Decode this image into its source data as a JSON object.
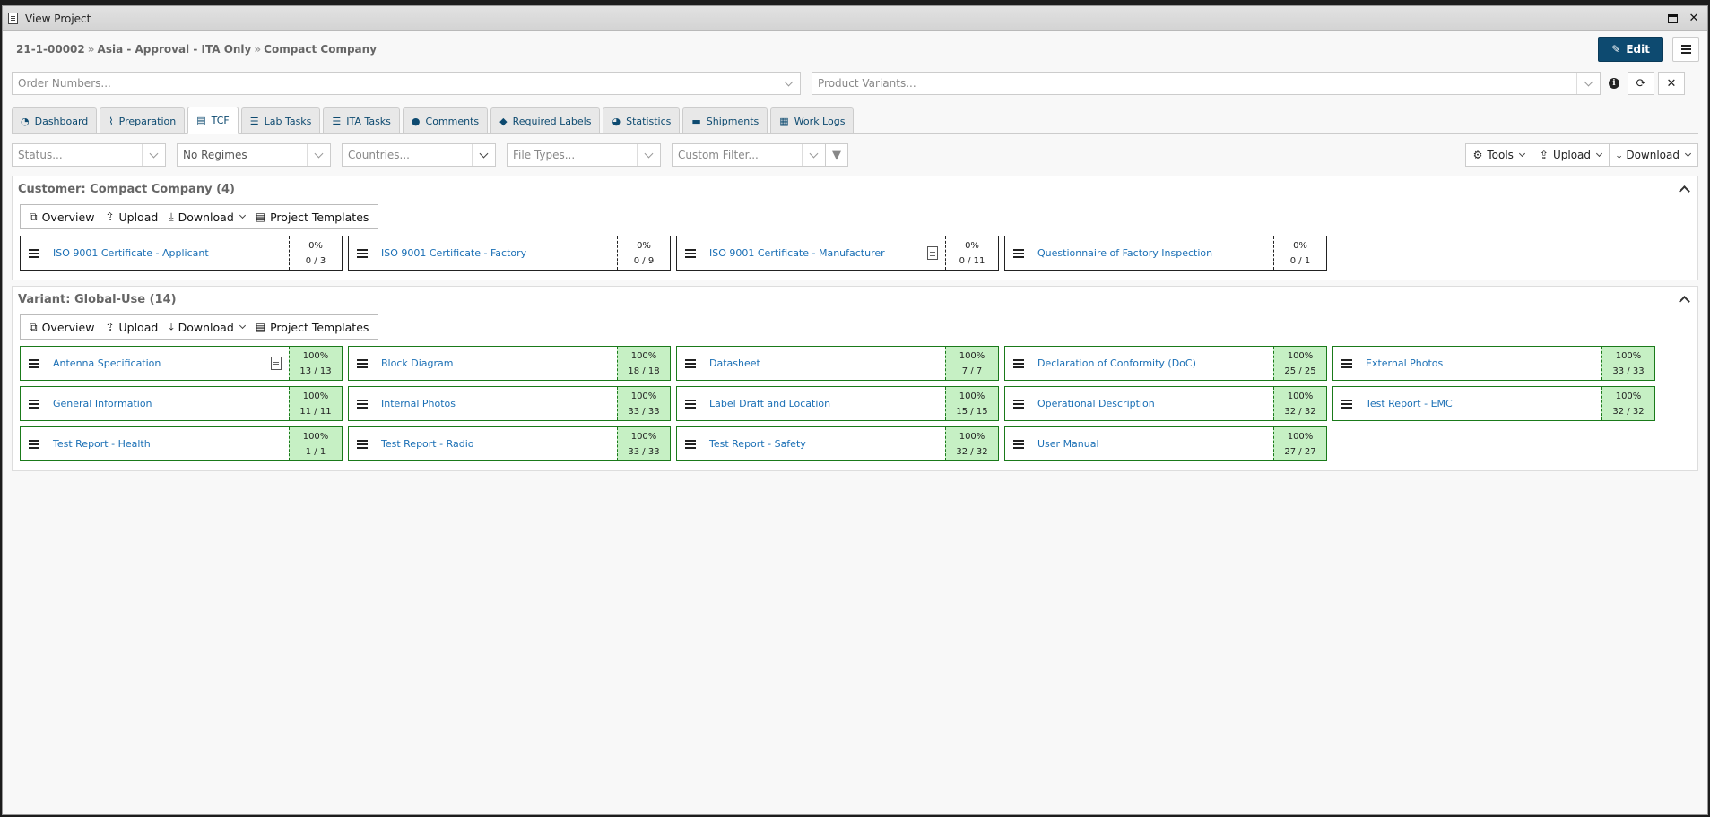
{
  "window": {
    "title": "View Project"
  },
  "breadcrumb": {
    "project_id": "21-1-00002",
    "approval": "Asia - Approval - ITA Only",
    "company": "Compact Company"
  },
  "header": {
    "edit_label": "Edit"
  },
  "selects": {
    "order_numbers": "Order Numbers...",
    "product_variants": "Product Variants..."
  },
  "tabs": [
    {
      "label": "Dashboard",
      "icon": "dashboard-icon"
    },
    {
      "label": "Preparation",
      "icon": "paperclip-icon"
    },
    {
      "label": "TCF",
      "icon": "file-icon",
      "active": true
    },
    {
      "label": "Lab Tasks",
      "icon": "server-icon"
    },
    {
      "label": "ITA Tasks",
      "icon": "server-icon"
    },
    {
      "label": "Comments",
      "icon": "comment-icon"
    },
    {
      "label": "Required Labels",
      "icon": "tags-icon"
    },
    {
      "label": "Statistics",
      "icon": "pie-chart-icon"
    },
    {
      "label": "Shipments",
      "icon": "truck-icon"
    },
    {
      "label": "Work Logs",
      "icon": "calculator-icon"
    }
  ],
  "filters": {
    "status": "Status...",
    "regimes": "No Regimes",
    "countries": "Countries...",
    "file_types": "File Types...",
    "custom_filter": "Custom Filter..."
  },
  "toolbar": {
    "tools": "Tools",
    "upload": "Upload",
    "download": "Download"
  },
  "actions": {
    "overview": "Overview",
    "upload": "Upload",
    "download": "Download",
    "templates": "Project Templates"
  },
  "customer": {
    "title": "Customer: Compact Company (4)",
    "cards": [
      {
        "label": "ISO 9001 Certificate - Applicant",
        "pct": "0%",
        "count": "0 / 3"
      },
      {
        "label": "ISO 9001 Certificate - Factory",
        "pct": "0%",
        "count": "0 / 9"
      },
      {
        "label": "ISO 9001 Certificate - Manufacturer",
        "pct": "0%",
        "count": "0 / 11"
      },
      {
        "label": "Questionnaire of Factory Inspection",
        "pct": "0%",
        "count": "0 / 1"
      }
    ]
  },
  "variant": {
    "title": "Variant: Global-Use (14)",
    "cards": [
      {
        "label": "Antenna Specification",
        "pct": "100%",
        "count": "13 / 13"
      },
      {
        "label": "Block Diagram",
        "pct": "100%",
        "count": "18 / 18"
      },
      {
        "label": "Datasheet",
        "pct": "100%",
        "count": "7 / 7"
      },
      {
        "label": "Declaration of Conformity (DoC)",
        "pct": "100%",
        "count": "25 / 25"
      },
      {
        "label": "External Photos",
        "pct": "100%",
        "count": "33 / 33"
      },
      {
        "label": "General Information",
        "pct": "100%",
        "count": "11 / 11"
      },
      {
        "label": "Internal Photos",
        "pct": "100%",
        "count": "33 / 33"
      },
      {
        "label": "Label Draft and Location",
        "pct": "100%",
        "count": "15 / 15"
      },
      {
        "label": "Operational Description",
        "pct": "100%",
        "count": "32 / 32"
      },
      {
        "label": "Test Report - EMC",
        "pct": "100%",
        "count": "32 / 32"
      },
      {
        "label": "Test Report - Health",
        "pct": "100%",
        "count": "1 / 1"
      },
      {
        "label": "Test Report - Radio",
        "pct": "100%",
        "count": "33 / 33"
      },
      {
        "label": "Test Report - Safety",
        "pct": "100%",
        "count": "32 / 32"
      },
      {
        "label": "User Manual",
        "pct": "100%",
        "count": "27 / 27"
      }
    ]
  },
  "colors": {
    "accent": "#0d4a70",
    "link": "#1a6fb5",
    "complete_bg": "#c6f0c4",
    "complete_border": "#1a7a1a"
  }
}
